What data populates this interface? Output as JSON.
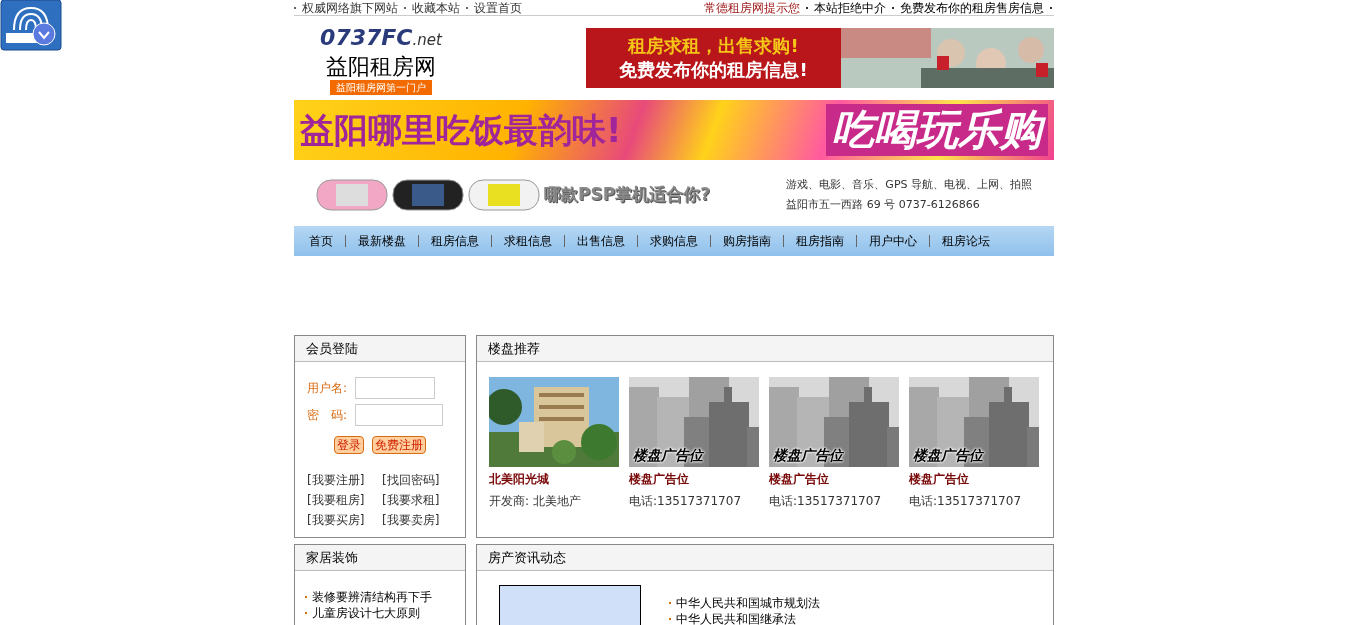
{
  "top_bar": {
    "links": [
      "权威网络旗下网站",
      "收藏本站",
      "设置首页"
    ],
    "notice": "常德租房网提示您",
    "notice_items": [
      "本站拒绝中介",
      "免费发布你的租房售房信息"
    ]
  },
  "logo": {
    "domain": "0737FC",
    "suffix": ".net",
    "name": "益阳租房网",
    "slogan": "益阳租房网第一门户"
  },
  "header_banner": {
    "lines": [
      "租房求租，出售求购!",
      "免费发布你的租房信息!"
    ]
  },
  "food_banner": {
    "headline": "益阳哪里吃饭最韵味!",
    "tagline": "吃喝玩乐购"
  },
  "psp_banner": {
    "headline": "哪款PSP掌机适合你?",
    "features": "游戏、电影、音乐、GPS 导航、电视、上网、拍照",
    "address": "益阳市五一西路 69 号  0737-6126866"
  },
  "nav": [
    {
      "label": "首页"
    },
    {
      "label": "最新楼盘"
    },
    {
      "label": "租房信息"
    },
    {
      "label": "求租信息"
    },
    {
      "label": "出售信息"
    },
    {
      "label": "求购信息"
    },
    {
      "label": "购房指南"
    },
    {
      "label": "租房指南"
    },
    {
      "label": "用户中心"
    },
    {
      "label": "租房论坛"
    }
  ],
  "login": {
    "title": "会员登陆",
    "username_label": "用户名:",
    "password_label": "密　码:",
    "buttons": [
      "登录",
      "免费注册"
    ],
    "links": [
      "[我要注册]",
      "[找回密码]",
      "[我要租房]",
      "[我要求租]",
      "[我要买房]",
      "[我要卖房]"
    ]
  },
  "featured": {
    "title": "楼盘推荐",
    "items": [
      {
        "name": "北美阳光城",
        "detail": "开发商: 北美地产"
      },
      {
        "kind": "placeholder",
        "overlay": "楼盘广告位",
        "name": "楼盘广告位",
        "detail": "电话:13517371707"
      },
      {
        "kind": "placeholder",
        "overlay": "楼盘广告位",
        "name": "楼盘广告位",
        "detail": "电话:13517371707"
      },
      {
        "kind": "placeholder",
        "overlay": "楼盘广告位",
        "name": "楼盘广告位",
        "detail": "电话:13517371707"
      }
    ]
  },
  "decor": {
    "title": "家居装饰",
    "items": [
      "装修要辨清结构再下手",
      "儿童房设计七大原则"
    ]
  },
  "news": {
    "title": "房产资讯动态",
    "items": [
      "中华人民共和国城市规划法",
      "中华人民共和国继承法"
    ]
  }
}
